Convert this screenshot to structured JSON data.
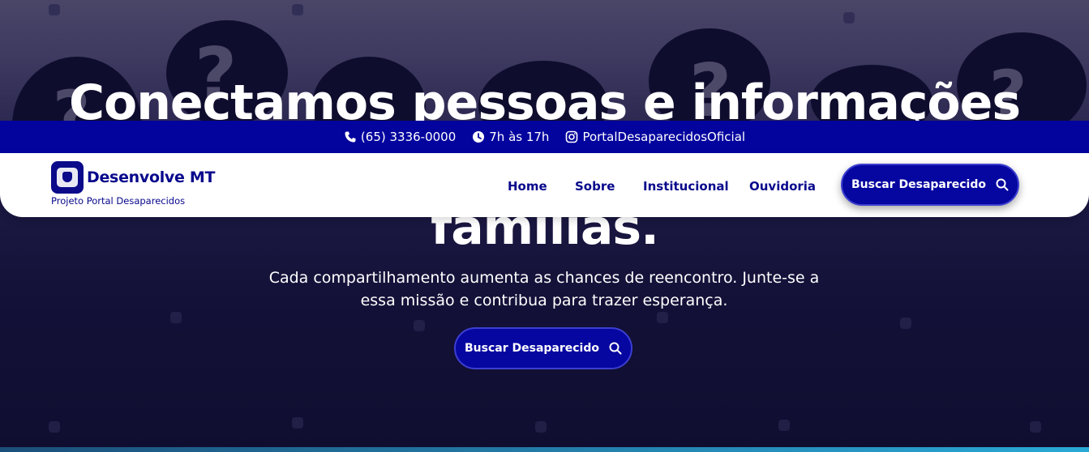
{
  "hero": {
    "title_line1": "Conectamos pessoas e informações",
    "title_line2": "famílias.",
    "subtitle": "Cada compartilhamento aumenta as chances de reencontro. Junte-se a essa missão e contribua para trazer esperança.",
    "button_label": "Buscar Desaparecido"
  },
  "topbar": {
    "phone": "(65) 3336-0000",
    "hours": "7h às 17h",
    "instagram": "PortalDesaparecidosOficial"
  },
  "navbar": {
    "brand_name": "Desenvolve MT",
    "brand_subtitle": "Projeto Portal Desaparecidos",
    "links": [
      "Home",
      "Sobre",
      "Institucional",
      "Ouvidoria"
    ],
    "button_label": "Buscar Desaparecido"
  },
  "colors": {
    "topbar_bg": "#03039e",
    "brand": "#08088c",
    "button_bg": "#0606a0",
    "hero_bg": "#110f33"
  },
  "icons": [
    "phone-icon",
    "clock-icon",
    "instagram-icon",
    "search-icon"
  ]
}
